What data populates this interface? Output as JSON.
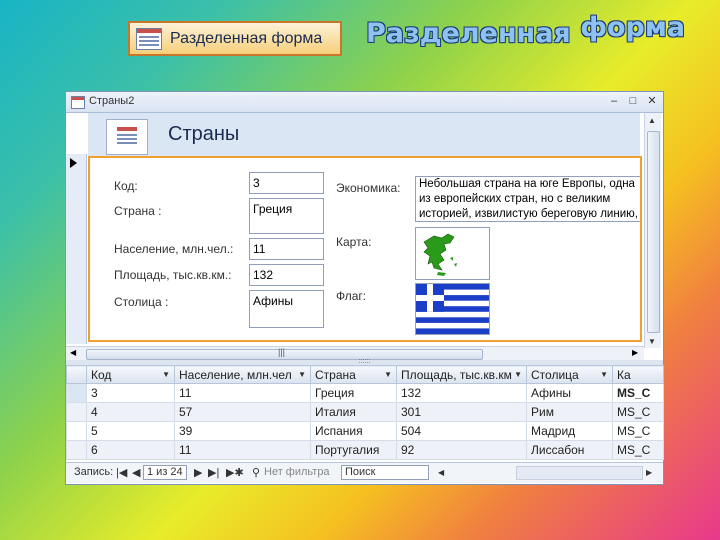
{
  "slide": {
    "button_label": "Разделенная форма",
    "title_word1": "Разделенная",
    "title_word2": "форма"
  },
  "window": {
    "title": "Страны2",
    "header_title": "Страны"
  },
  "form": {
    "labels": {
      "code": "Код:",
      "country": "Страна :",
      "population": "Население, млн.чел.:",
      "area": "Площадь, тыс.кв.км.:",
      "capital": "Столица :",
      "economy": "Экономика:",
      "map": "Карта:",
      "flag": "Флаг:"
    },
    "values": {
      "code": "3",
      "country": "Греция",
      "population": "11",
      "area": "132",
      "capital": "Афины",
      "economy": "Небольшая страна на юге Европы, одна из европейских стран, но с великим историей, извилистую береговую линию, что спо"
    }
  },
  "table": {
    "columns": [
      "Код",
      "Население, млн.чел",
      "Страна",
      "Площадь, тыс.кв.км",
      "Столица",
      "Ка"
    ],
    "rows": [
      {
        "code": "3",
        "population": "11",
        "country": "Греция",
        "area": "132",
        "capital": "Афины",
        "extra": "MS_C"
      },
      {
        "code": "4",
        "population": "57",
        "country": "Италия",
        "area": "301",
        "capital": "Рим",
        "extra": "MS_C"
      },
      {
        "code": "5",
        "population": "39",
        "country": "Испания",
        "area": "504",
        "capital": "Мадрид",
        "extra": "MS_C"
      },
      {
        "code": "6",
        "population": "11",
        "country": "Португалия",
        "area": "92",
        "capital": "Лиссабон",
        "extra": "MS_C"
      }
    ]
  },
  "navigation": {
    "record_label": "Запись:",
    "record_position": "1 из 24",
    "filter_label": "Нет фильтра",
    "search_label": "Поиск"
  },
  "colors": {
    "flag_blue": "#1a3ec8",
    "map_green": "#2a9a1a",
    "form_border": "#f0a030"
  }
}
